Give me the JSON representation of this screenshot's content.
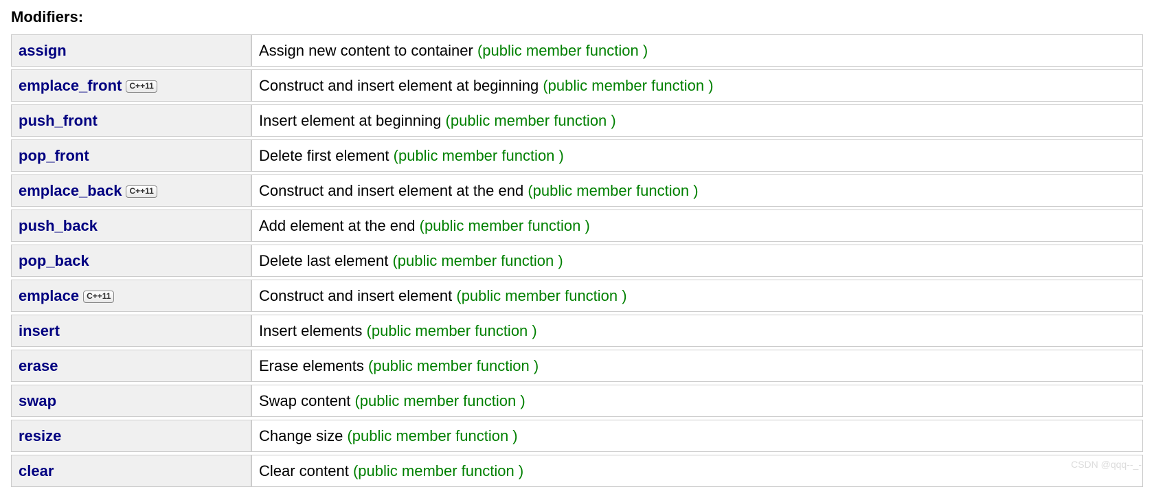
{
  "section_title": "Modifiers:",
  "annotation_text": "(public member function )",
  "cpp_badge_text": "C++11",
  "rows": [
    {
      "name": "assign",
      "badge": false,
      "desc": "Assign new content to container "
    },
    {
      "name": "emplace_front",
      "badge": true,
      "desc": "Construct and insert element at beginning "
    },
    {
      "name": "push_front",
      "badge": false,
      "desc": "Insert element at beginning "
    },
    {
      "name": "pop_front",
      "badge": false,
      "desc": "Delete first element "
    },
    {
      "name": "emplace_back",
      "badge": true,
      "desc": "Construct and insert element at the end "
    },
    {
      "name": "push_back",
      "badge": false,
      "desc": "Add element at the end "
    },
    {
      "name": "pop_back",
      "badge": false,
      "desc": "Delete last element "
    },
    {
      "name": "emplace",
      "badge": true,
      "desc": "Construct and insert element "
    },
    {
      "name": "insert",
      "badge": false,
      "desc": "Insert elements "
    },
    {
      "name": "erase",
      "badge": false,
      "desc": "Erase elements "
    },
    {
      "name": "swap",
      "badge": false,
      "desc": "Swap content "
    },
    {
      "name": "resize",
      "badge": false,
      "desc": "Change size "
    },
    {
      "name": "clear",
      "badge": false,
      "desc": "Clear content "
    }
  ],
  "watermark": "CSDN @qqq--_-"
}
